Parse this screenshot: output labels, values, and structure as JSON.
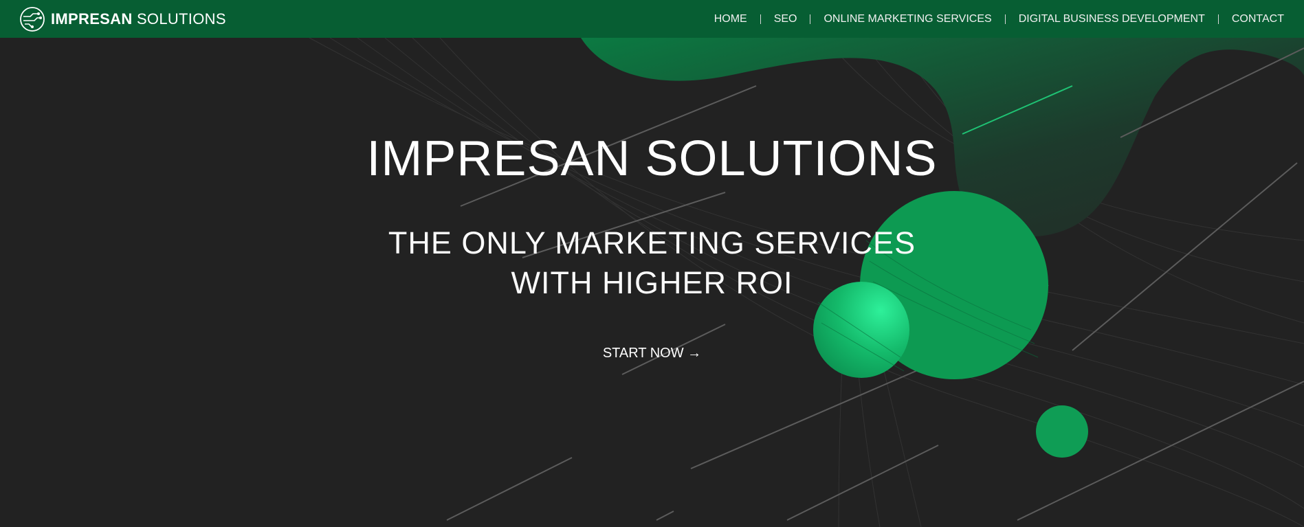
{
  "brand": {
    "name_bold": "IMPRESAN",
    "name_light": "SOLUTIONS",
    "logo_icon": "circuit-logo-icon"
  },
  "nav": {
    "items": [
      {
        "label": "HOME"
      },
      {
        "label": "SEO"
      },
      {
        "label": "ONLINE MARKETING SERVICES"
      },
      {
        "label": "DIGITAL BUSINESS DEVELOPMENT"
      },
      {
        "label": "CONTACT"
      }
    ]
  },
  "hero": {
    "title": "IMPRESAN SOLUTIONS",
    "subtitle_line1": "THE ONLY MARKETING SERVICES",
    "subtitle_line2": "WITH HIGHER ROI",
    "cta_label": "START NOW →"
  },
  "colors": {
    "header_bg": "#075e33",
    "page_bg": "#222222",
    "accent_green": "#0d9a52",
    "highlight_green": "#22e08a"
  }
}
